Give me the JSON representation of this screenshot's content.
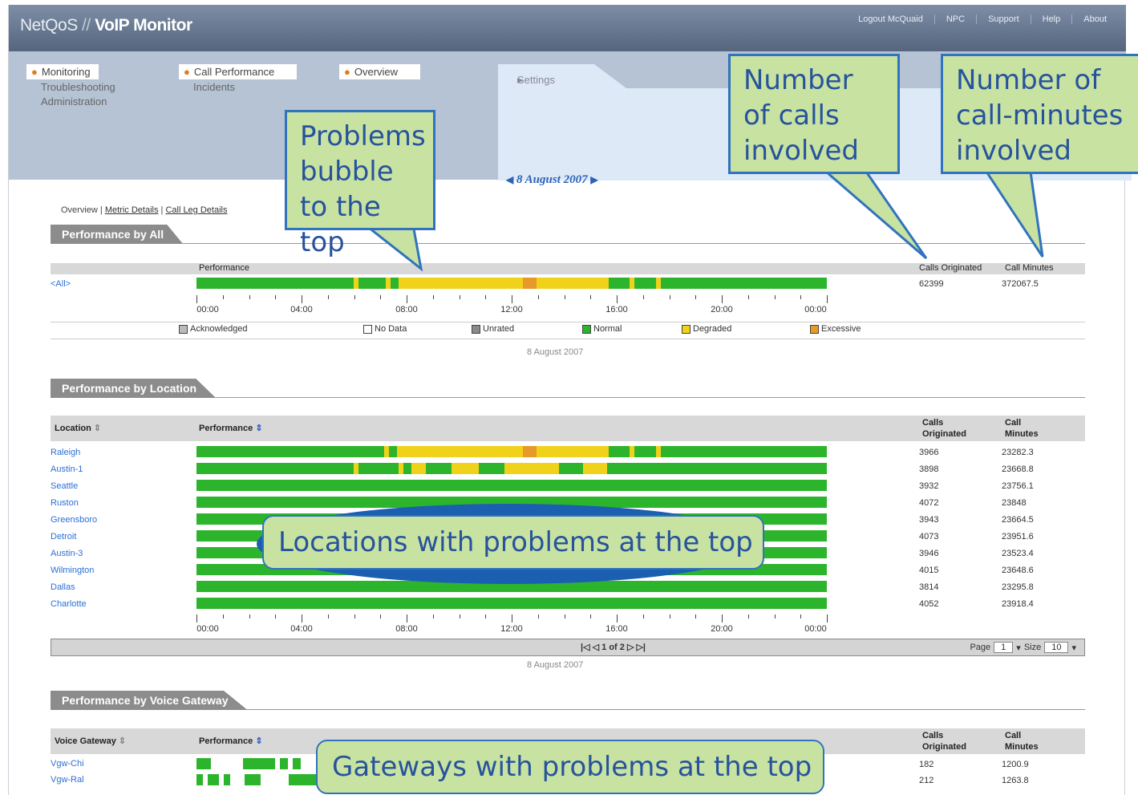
{
  "app": {
    "brand": "NetQoS",
    "product": "VoIP Monitor"
  },
  "toplinks": [
    "Logout McQuaid",
    "NPC",
    "Support",
    "Help",
    "About"
  ],
  "nav": {
    "col1": {
      "selected": "Monitoring",
      "items": [
        "Troubleshooting",
        "Administration"
      ]
    },
    "col2": {
      "selected": "Call Performance",
      "items": [
        "Incidents"
      ]
    },
    "col3": {
      "selected": "Overview"
    },
    "settings": "Settings"
  },
  "date_nav": "8 August 2007",
  "crumbs": {
    "current": "Overview",
    "link1": "Metric Details",
    "link2": "Call Leg Details"
  },
  "sections": {
    "all": "Performance by All",
    "location": "Performance by Location",
    "gateway": "Performance by Voice Gateway"
  },
  "all_table": {
    "col_perf": "Performance",
    "col_calls": "Calls Originated",
    "col_minutes": "Call Minutes",
    "row": {
      "name": "<All>",
      "calls": "62399",
      "minutes": "372067.5"
    }
  },
  "axis_labels": [
    "00:00",
    "04:00",
    "08:00",
    "12:00",
    "16:00",
    "20:00",
    "00:00"
  ],
  "legend": [
    "Acknowledged",
    "No Data",
    "Unrated",
    "Normal",
    "Degraded",
    "Excessive"
  ],
  "colors": {
    "normal": "#2cb52c",
    "degraded": "#f0d21a",
    "excessive": "#e79a2a",
    "unrated": "#8a8a8a"
  },
  "date_caption": "8 August 2007",
  "location_table": {
    "col_location": "Location",
    "col_perf": "Performance",
    "col_calls1": "Calls",
    "col_calls2": "Originated",
    "col_min1": "Call",
    "col_min2": "Minutes",
    "rows": [
      {
        "name": "Raleigh",
        "calls": "3966",
        "minutes": "23282.3"
      },
      {
        "name": "Austin-1",
        "calls": "3898",
        "minutes": "23668.8"
      },
      {
        "name": "Seattle",
        "calls": "3932",
        "minutes": "23756.1"
      },
      {
        "name": "Ruston",
        "calls": "4072",
        "minutes": "23848"
      },
      {
        "name": "Greensboro",
        "calls": "3943",
        "minutes": "23664.5"
      },
      {
        "name": "Detroit",
        "calls": "4073",
        "minutes": "23951.6"
      },
      {
        "name": "Austin-3",
        "calls": "3946",
        "minutes": "23523.4"
      },
      {
        "name": "Wilmington",
        "calls": "4015",
        "minutes": "23648.6"
      },
      {
        "name": "Dallas",
        "calls": "3814",
        "minutes": "23295.8"
      },
      {
        "name": "Charlotte",
        "calls": "4052",
        "minutes": "23918.4"
      }
    ]
  },
  "pager": {
    "nav": "1 of 2",
    "page_label": "Page",
    "page_value": "1",
    "size_label": "Size",
    "size_value": "10"
  },
  "gateway_table": {
    "col_gateway": "Voice Gateway",
    "col_perf": "Performance",
    "col_calls1": "Calls",
    "col_calls2": "Originated",
    "col_min1": "Call",
    "col_min2": "Minutes",
    "rows": [
      {
        "name": "Vgw-Chi",
        "calls": "182",
        "minutes": "1200.9"
      },
      {
        "name": "Vgw-Ral",
        "calls": "212",
        "minutes": "1263.8"
      }
    ]
  },
  "callouts": {
    "problems": "Problems bubble to the top",
    "calls": "Number of calls involved",
    "minutes": "Number of call-minutes involved",
    "locations": "Locations with problems at the top",
    "gateways": "Gateways with problems at the top"
  }
}
